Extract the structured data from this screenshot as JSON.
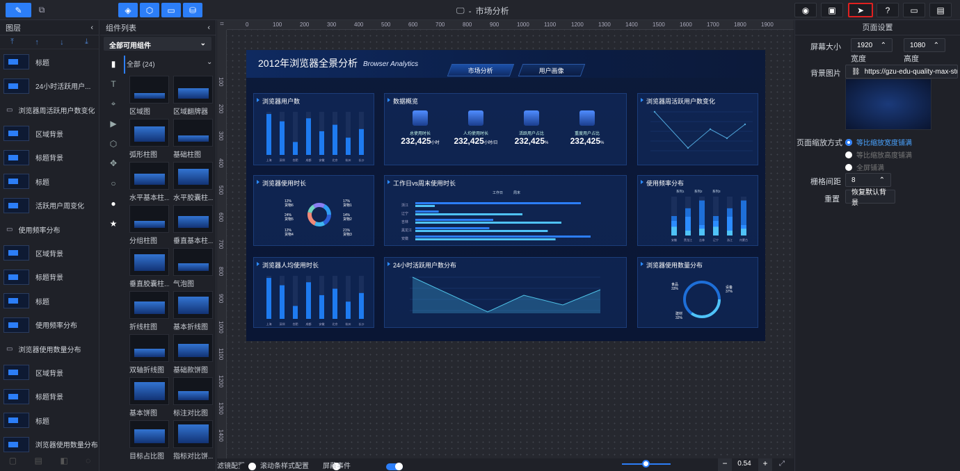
{
  "app": {
    "title": "市场分析"
  },
  "layers": {
    "header": "图层",
    "items": [
      {
        "label": "标题",
        "kind": "thumb"
      },
      {
        "label": "24小时活跃用户...",
        "kind": "thumb"
      },
      {
        "label": "浏览器周活跃用户数变化",
        "kind": "folder"
      },
      {
        "label": "区域背景",
        "kind": "thumb"
      },
      {
        "label": "标题背景",
        "kind": "thumb"
      },
      {
        "label": "标题",
        "kind": "thumb"
      },
      {
        "label": "活跃用户周变化",
        "kind": "thumb"
      },
      {
        "label": "使用频率分布",
        "kind": "folder"
      },
      {
        "label": "区域背景",
        "kind": "thumb"
      },
      {
        "label": "标题背景",
        "kind": "thumb"
      },
      {
        "label": "标题",
        "kind": "thumb"
      },
      {
        "label": "使用频率分布",
        "kind": "thumb"
      },
      {
        "label": "浏览器使用数量分布",
        "kind": "folder"
      },
      {
        "label": "区域背景",
        "kind": "thumb"
      },
      {
        "label": "标题背景",
        "kind": "thumb"
      },
      {
        "label": "标题",
        "kind": "thumb"
      },
      {
        "label": "浏览器使用数量分布",
        "kind": "thumb"
      }
    ]
  },
  "components": {
    "header": "组件列表",
    "select": "全部可用组件",
    "all_label": "全部 (24)",
    "items": [
      "区域图",
      "区域翻牌器",
      "弧形柱图",
      "基础柱图",
      "水平基本柱...",
      "水平胶囊柱...",
      "分组柱图",
      "垂直基本柱...",
      "垂直胶囊柱...",
      "气泡图",
      "折线柱图",
      "基本折线图",
      "双轴折线图",
      "基础款饼图",
      "基本饼图",
      "标注对比图",
      "目标占比图",
      "指标对比饼..."
    ]
  },
  "dashboard": {
    "title": "2012年浏览器全景分析",
    "subtitle": "Browser Analytics",
    "tabs": [
      "市场分析",
      "用户画像"
    ],
    "cards": {
      "users": "浏览器用户数",
      "overview": "数据概览",
      "weekly": "浏览器周活跃用户数变化",
      "duration": "浏览器使用时长",
      "weekday": "工作日vs周末使用时长",
      "frequency": "使用频率分布",
      "avg": "浏览器人均使用时长",
      "active24": "24小时活跃用户数分布",
      "count": "浏览器使用数量分布"
    },
    "stats": [
      {
        "label": "总使用时长",
        "value": "232,425",
        "unit": "小时"
      },
      {
        "label": "人均使用时长",
        "value": "232,425",
        "unit": "小时/日"
      },
      {
        "label": "活跃用户占比",
        "value": "232,425",
        "unit": "%"
      },
      {
        "label": "重度用户占比",
        "value": "232,425",
        "unit": "%"
      }
    ],
    "bar_cities": [
      "上海",
      "深圳",
      "合肥",
      "成都",
      "安徽",
      "北京",
      "杭州",
      "长沙"
    ],
    "donut_labels": [
      "12%\n货物6",
      "17%\n货物1",
      "24%\n货物5",
      "14%\n货物2",
      "12%\n货物4",
      "21%\n货物3"
    ],
    "hbar_legend": [
      "工作日",
      "周末"
    ],
    "hbar_cats": [
      "浙江",
      "辽宁",
      "吉林",
      "黑龙江",
      "安徽"
    ],
    "freq_legend": [
      "系列1",
      "系列2",
      "系列3"
    ],
    "freq_cats": [
      "安徽",
      "黑龙江",
      "吉林",
      "辽宁",
      "浙江",
      "内蒙古"
    ],
    "ring_labels": [
      "食品\n33%",
      "设备\n37%",
      "建材\n32%"
    ]
  },
  "props": {
    "header": "页面设置",
    "screen_size_label": "屏幕大小",
    "width_value": "1920",
    "height_value": "1080",
    "width_label": "宽度",
    "height_label": "高度",
    "bg_image_label": "背景图片",
    "bg_image_url": "https://gzu-edu-quality-max-studio",
    "scale_label": "页面缩放方式",
    "scale_options": [
      "等比缩放宽度铺满",
      "等比缩放高度铺满",
      "全屏铺满"
    ],
    "grid_label": "栅格间距",
    "grid_value": "8",
    "reset_label": "重置",
    "reset_button": "恢复默认背景"
  },
  "bottom": {
    "toggle1": "滤镜配置",
    "toggle2": "滚动条样式配置",
    "toggle3": "屏蔽事件",
    "zoom": "0.54",
    "minus": "−",
    "plus": "+"
  },
  "ruler_h": [
    "0",
    "100",
    "200",
    "300",
    "400",
    "500",
    "600",
    "700",
    "800",
    "900",
    "1000",
    "1100",
    "1200",
    "1300",
    "1400",
    "1500",
    "1600",
    "1700",
    "1800",
    "1900"
  ],
  "ruler_v": [
    "100",
    "200",
    "300",
    "400",
    "500",
    "600",
    "700",
    "800",
    "900",
    "1000",
    "1100",
    "1200",
    "1300",
    "1400"
  ]
}
